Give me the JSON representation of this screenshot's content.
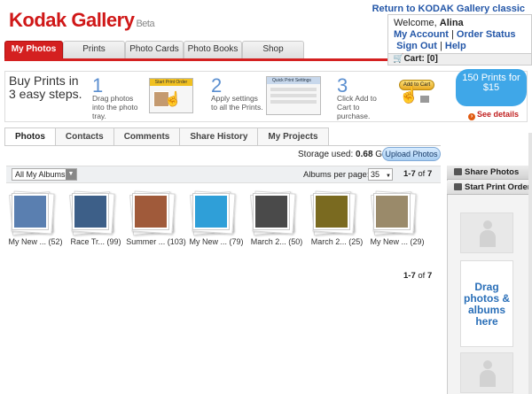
{
  "header": {
    "logo_main": "Kodak Gallery",
    "logo_beta": "Beta",
    "classic_link": "Return to KODAK Gallery classic",
    "welcome_prefix": "Welcome,",
    "user_name": "Alina",
    "my_account": "My Account",
    "order_status": "Order Status",
    "sign_out": "Sign Out",
    "help": "Help",
    "cart": "Cart: [0]"
  },
  "top_tabs": [
    {
      "label": "My Photos",
      "active": true
    },
    {
      "label": "Prints"
    },
    {
      "label": "Photo Cards"
    },
    {
      "label": "Photo Books"
    },
    {
      "label": "Shop"
    }
  ],
  "steps": {
    "title": "Buy Prints in 3 easy steps.",
    "items": [
      {
        "num": "1",
        "text": "Drag photos into the photo tray.",
        "img_label": "Start Print Order"
      },
      {
        "num": "2",
        "text": "Apply settings to all the Prints.",
        "img_label": "Quick Print Settings"
      },
      {
        "num": "3",
        "text": "Click Add to Cart to purchase.",
        "img_label": "Add to Cart"
      }
    ],
    "promo": "150 Prints for $15",
    "details": "See details"
  },
  "sub_tabs": [
    {
      "label": "Photos",
      "active": true
    },
    {
      "label": "Contacts"
    },
    {
      "label": "Comments"
    },
    {
      "label": "Share History"
    },
    {
      "label": "My Projects"
    }
  ],
  "storage": {
    "label": "Storage used:",
    "value": "0.68",
    "unit": "GB"
  },
  "upload_button": "Upload Photos",
  "filter": {
    "album_select": "All My Albums",
    "per_page_label": "Albums per page:",
    "per_page_value": "35",
    "range": "1-7",
    "range_of": "of",
    "range_total": "7"
  },
  "albums": [
    {
      "label": "My New ... (52)",
      "color": "#5a7fb0"
    },
    {
      "label": "Race Tr... (99)",
      "color": "#3d5f88"
    },
    {
      "label": "Summer ... (103)",
      "color": "#a05a3a"
    },
    {
      "label": "My New ... (79)",
      "color": "#2f9fd8"
    },
    {
      "label": "March 2... (50)",
      "color": "#4a4a4a"
    },
    {
      "label": "March 2... (25)",
      "color": "#7a6a20"
    },
    {
      "label": "My New ... (29)",
      "color": "#9a8a6a"
    }
  ],
  "tray": {
    "share": "Share Photos",
    "print": "Start Print Order",
    "drag_text": "Drag photos & albums here"
  },
  "colors": {
    "brand_red": "#d42020",
    "link_blue": "#2457a8",
    "promo_blue": "#3fa7e8"
  }
}
